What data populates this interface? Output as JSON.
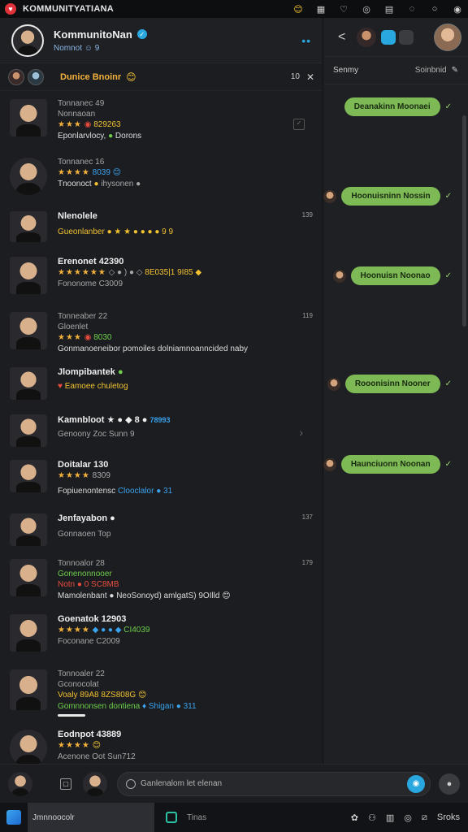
{
  "window": {
    "title": "KOMMUNITYATIANA",
    "icons": [
      "emoji-icon",
      "grid-icon",
      "heart-icon",
      "clock-icon",
      "calendar-icon",
      "chat-icon",
      "circle-icon",
      "power-icon"
    ],
    "icon_glyphs": [
      "😊",
      "▦",
      "♡",
      "◎",
      "▤",
      "◌",
      "○",
      "◉"
    ]
  },
  "chat_header": {
    "name": "KommunitoNan",
    "status": "Nomnot ☺ 9",
    "more": "••"
  },
  "group_bar": {
    "label": "Dunice Bnoinr",
    "emoji": "😊",
    "count": "10",
    "close": "✕"
  },
  "conversations": [
    {
      "name": "Tonnanec 49",
      "line2_a": "Nonnaoan",
      "line2_b": "★★★",
      "line2_c": "◉",
      "line2_d": "829263",
      "line3_a": "Eponlarvlocy,",
      "line3_b": "●",
      "line3_c": "Dorons",
      "time": "",
      "accent": "check"
    },
    {
      "name": "Tonnanec 16",
      "line2_a": "",
      "line2_b": "★★★★",
      "line2_c": "",
      "line2_d": "8039 😊",
      "line3_a": "Tnoonoct",
      "line3_b": "●",
      "line3_c": "ihysonen ●",
      "time": "",
      "accent": ""
    },
    {
      "name": "Nlenolele",
      "line2_a": "",
      "line2_b": "",
      "line2_c": "",
      "line2_d": "",
      "line3_a": "Gueonlanber ● ★ ★ ● ● ● ● 9 9",
      "line3_b": "",
      "line3_c": "",
      "time": "139",
      "accent": ""
    },
    {
      "name": "Erenonet 42390",
      "line2_a": "",
      "line2_b": "★★★★★★",
      "line2_c": "◇ ● ) ● ◇",
      "line2_d": "8E035|1 9I85 ◆",
      "line3_a": "Fononome C3009",
      "line3_b": "",
      "line3_c": "",
      "time": "",
      "accent": ""
    },
    {
      "name": "Tonneaber 22",
      "line2_a": "Gloenlet",
      "line2_b": "★★★",
      "line2_c": "◉",
      "line2_d": "8030",
      "line3_a": "Gonmanoeneibor pomoiles dolniamnoanncided naby",
      "line3_b": "",
      "line3_c": "",
      "time": "119",
      "accent": ""
    },
    {
      "name": "Jlompibantek",
      "line2_a": "",
      "line2_b": "",
      "line2_c": "♥",
      "line2_d": "Eamoee chuletog",
      "line3_a": "",
      "line3_b": "",
      "line3_c": "",
      "time": "",
      "accent": ""
    },
    {
      "name": "Kamnbloot ★ ● ◆ 8 ●",
      "line2_a": "",
      "line2_b": "",
      "line2_c": "",
      "line2_d": "78993",
      "line3_a": "Genoony Zoc Sunn 9",
      "line3_b": "",
      "line3_c": "",
      "time": "",
      "accent": "chev"
    },
    {
      "name": "Doitalar 130",
      "line2_a": "",
      "line2_b": "★★★★",
      "line2_c": "",
      "line2_d": "8309",
      "line3_a": "Fopiuenontensc",
      "line3_b": "Clooclalor ●",
      "line3_c": "31",
      "time": "",
      "accent": ""
    },
    {
      "name": "Jenfayabon ●",
      "line2_a": "Gonnaoen Top",
      "line2_b": "",
      "line2_c": "",
      "line2_d": "",
      "line3_a": "",
      "line3_b": "",
      "line3_c": "",
      "time": "137",
      "accent": ""
    },
    {
      "name": "Tonnoalor 28",
      "line2_a": "Gonenonnooer",
      "line2_b": "",
      "line2_c": "",
      "line2_d": "Notn ● 0 SC8MB",
      "line3_a": "Mamolenbant ● NeoSonoyd) amlgatS) 9OIlld 😊",
      "line3_b": "",
      "line3_c": "",
      "time": "179",
      "accent": ""
    },
    {
      "name": "Goenatok 12903",
      "line2_a": "",
      "line2_b": "★★★★",
      "line2_c": "◆ ● ● ◆",
      "line2_d": "CI4039",
      "line3_a": "Foconane C2009",
      "line3_b": "",
      "line3_c": "",
      "time": "",
      "accent": ""
    },
    {
      "name": "Tonnoaler 22",
      "line2_a": "Gconocolat",
      "line2_b": "",
      "line2_c": "Voaly",
      "line2_d": "89A8 8ZS808G 😊",
      "line3_a": "Gomnnonsen dontiena",
      "line3_b": "♦ Shigan ●",
      "line3_c": "311",
      "time": "",
      "accent": "progress"
    },
    {
      "name": "Eodnpot 43889",
      "line2_a": "",
      "line2_b": "★★★★",
      "line2_c": "",
      "line2_d": "😊",
      "line3_a": "Acenone Oot Sun712",
      "line3_b": "",
      "line3_c": "",
      "time": "",
      "accent": ""
    }
  ],
  "right_panel": {
    "back": "<",
    "tab_left": "Senmy",
    "tab_right": "Soinbnid",
    "edit": "✎",
    "bubbles": [
      {
        "text": "Deanakinn Moonaei",
        "tick": "✓",
        "has_avatar": false
      },
      {
        "text": "Hoonuisninn Nossin",
        "tick": "✓",
        "has_avatar": true
      },
      {
        "text": "Hoonuisn Noonao",
        "tick": "✓",
        "has_avatar": true
      },
      {
        "text": "Rooonisinn Nooner",
        "tick": "✓",
        "has_avatar": true
      },
      {
        "text": "Haunciuonn Noonan",
        "tick": "✓",
        "has_avatar": true
      }
    ]
  },
  "input_bar": {
    "placeholder": "Ganlenalom let elenan",
    "frame_icon": "▢",
    "send": "◉",
    "mic": "●"
  },
  "taskbar": {
    "search_text": "Jmnnoocolr",
    "app_label": "Tinas",
    "tray": [
      "✿",
      "⚇",
      "▥",
      "◎",
      "⧄",
      "Sroks"
    ]
  }
}
